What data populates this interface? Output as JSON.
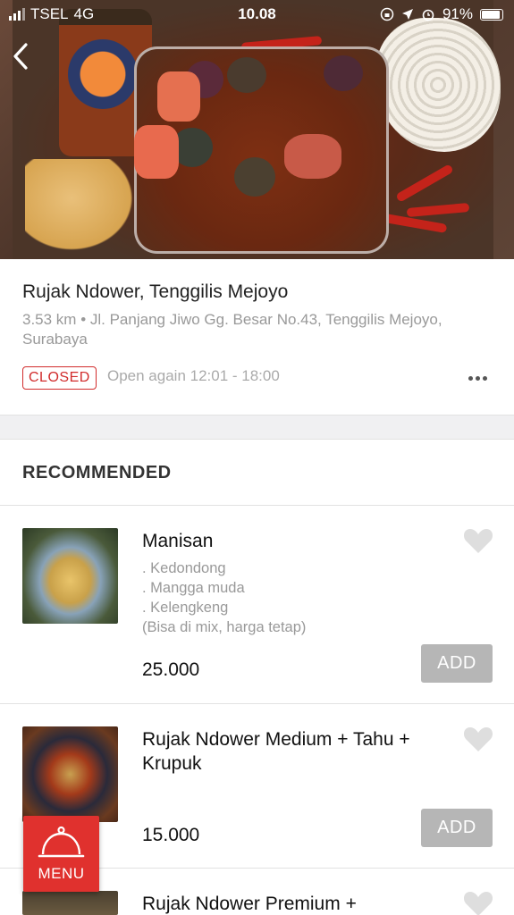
{
  "status_bar": {
    "carrier": "TSEL",
    "network": "4G",
    "time": "10.08",
    "battery": "91%"
  },
  "restaurant": {
    "name": "Rujak Ndower, Tenggilis Mejoyo",
    "address": "3.53 km • Jl. Panjang Jiwo Gg. Besar No.43, Tenggilis Mejoyo, Surabaya",
    "status_badge": "CLOSED",
    "open_again": "Open again 12:01 - 18:00"
  },
  "section": {
    "title": "RECOMMENDED"
  },
  "items": [
    {
      "name": "Manisan",
      "description": [
        ". Kedondong",
        ". Mangga muda",
        ". Kelengkeng",
        "(Bisa di mix, harga tetap)"
      ],
      "price": "25.000",
      "add_label": "ADD"
    },
    {
      "name": "Rujak Ndower Medium + Tahu + Krupuk",
      "description": [],
      "price": "15.000",
      "add_label": "ADD"
    },
    {
      "name": "Rujak Ndower Premium +",
      "description": [],
      "price": "",
      "add_label": ""
    }
  ],
  "menu_button": {
    "label": "MENU"
  },
  "colors": {
    "accent": "#e0312e",
    "badge": "#d12c2c",
    "add_button": "#b6b6b6"
  },
  "icons": [
    "back-arrow-icon",
    "more-icon",
    "heart-icon",
    "cloche-icon"
  ]
}
